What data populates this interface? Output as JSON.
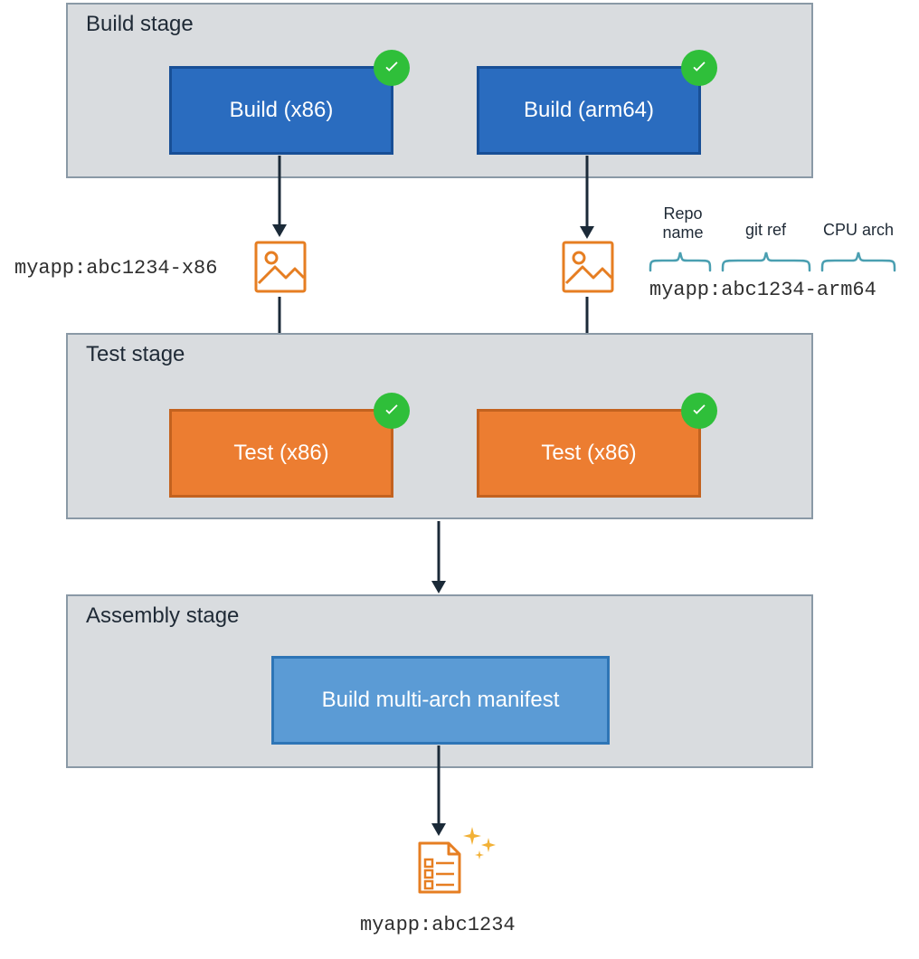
{
  "stages": {
    "build": {
      "title": "Build stage",
      "jobs": {
        "x86": "Build (x86)",
        "arm64": "Build (arm64)"
      }
    },
    "test": {
      "title": "Test stage",
      "jobs": {
        "left": "Test (x86)",
        "right": "Test (x86)"
      }
    },
    "assembly": {
      "title": "Assembly stage",
      "job": "Build multi-arch manifest"
    }
  },
  "artifacts": {
    "x86_tag": "myapp:abc1234-x86",
    "arm64_tag": "myapp:abc1234-arm64",
    "final_tag": "myapp:abc1234"
  },
  "annotations": {
    "repo_name": "Repo\nname",
    "git_ref": "git ref",
    "cpu_arch": "CPU arch"
  },
  "colors": {
    "build_job": "#2a6cbf",
    "test_job": "#ec7d31",
    "assembly_job": "#5b9bd5",
    "success_badge": "#2fbf3a",
    "icon": "#e67e22",
    "brace": "#4a9fb1"
  }
}
